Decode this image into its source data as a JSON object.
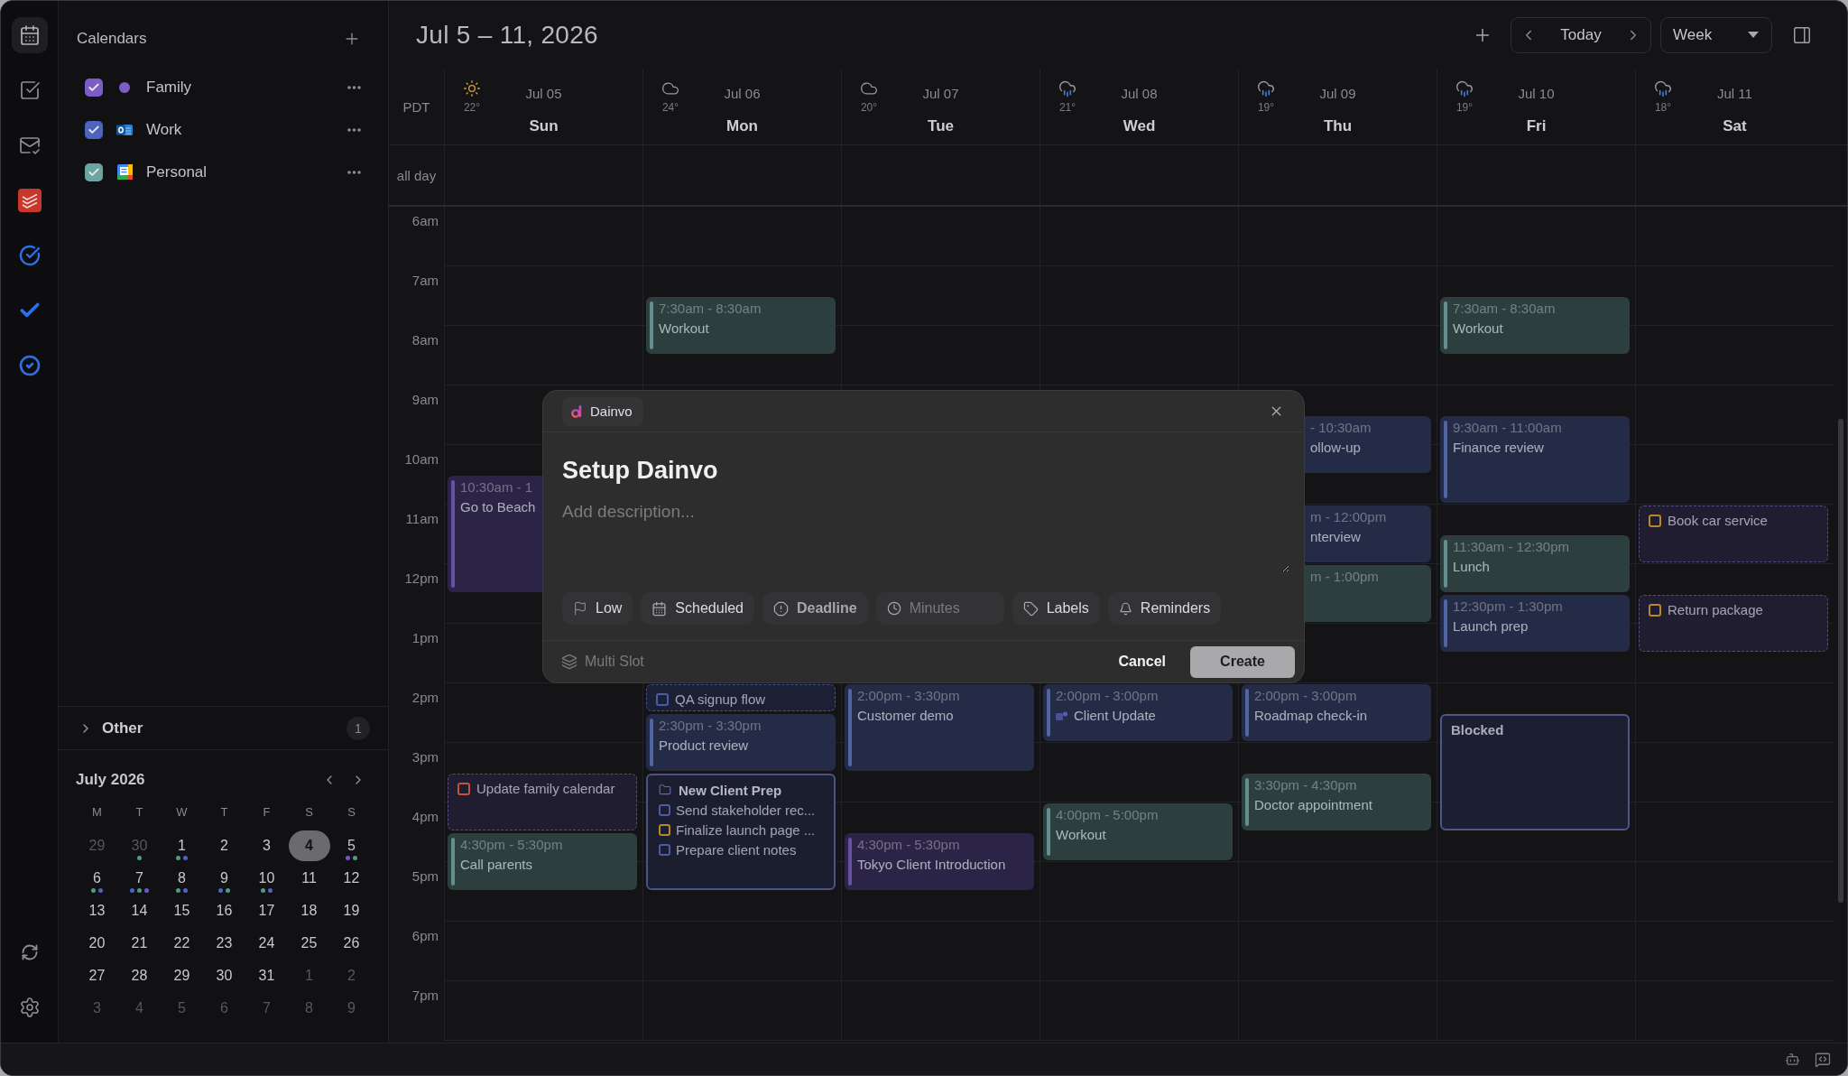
{
  "rail": [
    {
      "selected": true
    },
    {
      "selected": false
    },
    {
      "selected": false
    },
    {
      "selected": false
    },
    {
      "selected": false
    },
    {
      "selected": false
    },
    {
      "selected": false
    }
  ],
  "sidebar": {
    "title": "Calendars",
    "calendars": [
      {
        "name": "Family",
        "checked": true,
        "color": "#7b5cc8"
      },
      {
        "name": "Work",
        "checked": true,
        "color": "#4d63bd"
      },
      {
        "name": "Personal",
        "checked": true,
        "color": "#6aa5a2"
      }
    ],
    "other": {
      "label": "Other",
      "count": "1",
      "expanded": false
    },
    "mini_calendar": {
      "title": "July 2026",
      "weekdays": [
        "M",
        "T",
        "W",
        "T",
        "F",
        "S",
        "S"
      ],
      "weeks": [
        [
          {
            "day": "29",
            "outside": true,
            "selected": false
          },
          {
            "day": "30",
            "outside": true,
            "selected": false,
            "dots": [
              {
                "color": "#4e9a8c"
              }
            ]
          },
          {
            "day": "1",
            "outside": false,
            "selected": false,
            "dots": [
              {
                "color": "#4e9a8c"
              },
              {
                "color": "#5063c2"
              }
            ]
          },
          {
            "day": "2",
            "outside": false,
            "selected": false
          },
          {
            "day": "3",
            "outside": false,
            "selected": false
          },
          {
            "day": "4",
            "outside": false,
            "selected": true
          },
          {
            "day": "5",
            "outside": false,
            "selected": false,
            "dots": [
              {
                "color": "#7656c4"
              },
              {
                "color": "#4e9a8c"
              }
            ]
          }
        ],
        [
          {
            "day": "6",
            "outside": false,
            "selected": false,
            "dots": [
              {
                "color": "#4e9a8c"
              },
              {
                "color": "#5063c2"
              }
            ]
          },
          {
            "day": "7",
            "outside": false,
            "selected": false,
            "dots": [
              {
                "color": "#5063c2"
              },
              {
                "color": "#4e9a8c"
              },
              {
                "color": "#7656c4"
              }
            ]
          },
          {
            "day": "8",
            "outside": false,
            "selected": false,
            "dots": [
              {
                "color": "#4e9a8c"
              },
              {
                "color": "#5063c2"
              }
            ]
          },
          {
            "day": "9",
            "outside": false,
            "selected": false,
            "dots": [
              {
                "color": "#5063c2"
              },
              {
                "color": "#4e9a8c"
              }
            ]
          },
          {
            "day": "10",
            "outside": false,
            "selected": false,
            "dots": [
              {
                "color": "#4e9a8c"
              },
              {
                "color": "#5063c2"
              }
            ]
          },
          {
            "day": "11",
            "outside": false,
            "selected": false
          },
          {
            "day": "12",
            "outside": false,
            "selected": false
          }
        ],
        [
          {
            "day": "13",
            "outside": false,
            "selected": false
          },
          {
            "day": "14",
            "outside": false,
            "selected": false
          },
          {
            "day": "15",
            "outside": false,
            "selected": false
          },
          {
            "day": "16",
            "outside": false,
            "selected": false
          },
          {
            "day": "17",
            "outside": false,
            "selected": false
          },
          {
            "day": "18",
            "outside": false,
            "selected": false
          },
          {
            "day": "19",
            "outside": false,
            "selected": false
          }
        ],
        [
          {
            "day": "20",
            "outside": false,
            "selected": false
          },
          {
            "day": "21",
            "outside": false,
            "selected": false
          },
          {
            "day": "22",
            "outside": false,
            "selected": false
          },
          {
            "day": "23",
            "outside": false,
            "selected": false
          },
          {
            "day": "24",
            "outside": false,
            "selected": false
          },
          {
            "day": "25",
            "outside": false,
            "selected": false
          },
          {
            "day": "26",
            "outside": false,
            "selected": false
          }
        ],
        [
          {
            "day": "27",
            "outside": false,
            "selected": false
          },
          {
            "day": "28",
            "outside": false,
            "selected": false
          },
          {
            "day": "29",
            "outside": false,
            "selected": false
          },
          {
            "day": "30",
            "outside": false,
            "selected": false
          },
          {
            "day": "31",
            "outside": false,
            "selected": false
          },
          {
            "day": "1",
            "outside": true,
            "selected": false
          },
          {
            "day": "2",
            "outside": true,
            "selected": false
          }
        ],
        [
          {
            "day": "3",
            "outside": true,
            "selected": false
          },
          {
            "day": "4",
            "outside": true,
            "selected": false
          },
          {
            "day": "5",
            "outside": true,
            "selected": false
          },
          {
            "day": "6",
            "outside": true,
            "selected": false
          },
          {
            "day": "7",
            "outside": true,
            "selected": false
          },
          {
            "day": "8",
            "outside": true,
            "selected": false
          },
          {
            "day": "9",
            "outside": true,
            "selected": false
          }
        ]
      ]
    }
  },
  "header": {
    "title": "Jul 5 – 11, 2026",
    "today": "Today",
    "view": "Week"
  },
  "week": {
    "timezone": "PDT",
    "all_day": "all day",
    "hours": [
      "6am",
      "7am",
      "8am",
      "9am",
      "10am",
      "11am",
      "12pm",
      "1pm",
      "2pm",
      "3pm",
      "4pm",
      "5pm",
      "6pm",
      "7pm"
    ],
    "days": [
      {
        "kind": "sun",
        "temp": "22°",
        "date": "Jul 05",
        "name": "Sun",
        "events": [
          {
            "kind": "event",
            "time": "10:30am - 1",
            "title": "Go to Beach",
            "color": "#2c2446"
          },
          {
            "kind": "task",
            "title": "Update family calendar",
            "checkbox": {
              "checked": false,
              "color": "#c4513c"
            },
            "color": "#211d30"
          },
          {
            "kind": "event",
            "time": "4:30pm - 5:30pm",
            "title": "Call parents",
            "color": "#2c3e3e"
          }
        ]
      },
      {
        "kind": "cloud",
        "temp": "24°",
        "date": "Jul 06",
        "name": "Mon",
        "events": [
          {
            "kind": "event",
            "time": "7:30am - 8:30am",
            "title": "Workout",
            "color": "#2c3e3e"
          },
          {
            "kind": "task",
            "title": "QA signup flow",
            "checkbox": {
              "checked": false,
              "color": "#4a5ca6"
            },
            "color": "#1b2034"
          },
          {
            "kind": "event",
            "time": "2:30pm - 3:30pm",
            "title": "Product review",
            "color": "#232b46"
          },
          {
            "kind": "group",
            "title": "New Client Prep",
            "color": "#1a1e2f",
            "items": [
              {
                "title": "Send stakeholder rec...",
                "checked": false,
                "color": "#4a5ca6"
              },
              {
                "title": "Finalize launch page ...",
                "checked": false,
                "color": "#b8862c"
              },
              {
                "title": "Prepare client notes",
                "checked": false,
                "color": "#4a5ca6"
              }
            ]
          }
        ]
      },
      {
        "kind": "cloud",
        "temp": "20°",
        "date": "Jul 07",
        "name": "Tue",
        "events": [
          {
            "kind": "event",
            "time": "2:00pm - 3:30pm",
            "title": "Customer demo",
            "color": "#232b46"
          },
          {
            "kind": "event",
            "time": "4:30pm - 5:30pm",
            "title": "Tokyo Client Introduction",
            "color": "#2c2446"
          }
        ]
      },
      {
        "kind": "rain",
        "temp": "21°",
        "date": "Jul 08",
        "name": "Wed",
        "events": [
          {
            "kind": "meeting",
            "time": "2:00pm - 3:00pm",
            "title": "Client Update",
            "color": "#232b46"
          },
          {
            "kind": "event",
            "time": "4:00pm - 5:00pm",
            "title": "Workout",
            "color": "#2c3e3e"
          }
        ]
      },
      {
        "kind": "rain",
        "temp": "19°",
        "date": "Jul 09",
        "name": "Thu",
        "events": [
          {
            "kind": "event",
            "time": "- 10:30am",
            "title": "ollow-up",
            "color": "#232b46"
          },
          {
            "kind": "event",
            "time": "m - 12:00pm",
            "title": "nterview",
            "color": "#232b46"
          },
          {
            "kind": "event",
            "time": "m - 1:00pm",
            "color": "#2c3e3e"
          },
          {
            "kind": "event",
            "time": "2:00pm - 3:00pm",
            "title": "Roadmap check-in",
            "color": "#232b46"
          },
          {
            "kind": "event",
            "time": "3:30pm - 4:30pm",
            "title": "Doctor appointment",
            "color": "#2c3e3e"
          }
        ]
      },
      {
        "kind": "rain",
        "temp": "19°",
        "date": "Jul 10",
        "name": "Fri",
        "events": [
          {
            "kind": "event",
            "time": "7:30am - 8:30am",
            "title": "Workout",
            "color": "#2c3e3e"
          },
          {
            "kind": "event",
            "time": "9:30am - 11:00am",
            "title": "Finance review",
            "color": "#232b46"
          },
          {
            "kind": "event",
            "time": "11:30am - 12:30pm",
            "title": "Lunch",
            "color": "#2c3e3e"
          },
          {
            "kind": "event",
            "time": "12:30pm - 1:30pm",
            "title": "Launch prep",
            "color": "#232b46"
          },
          {
            "kind": "blocked",
            "title": "Blocked",
            "color": "#1b1f31"
          }
        ]
      },
      {
        "kind": "rain",
        "temp": "18°",
        "date": "Jul 11",
        "name": "Sat",
        "events": [
          {
            "kind": "task",
            "title": "Book car service",
            "checkbox": {
              "checked": false,
              "color": "#b8862c"
            },
            "color": "#211d30"
          },
          {
            "kind": "task",
            "title": "Return package",
            "checkbox": {
              "checked": false,
              "color": "#b8862c"
            },
            "color": "#211d30"
          }
        ]
      }
    ]
  },
  "dialog": {
    "source": "Dainvo",
    "title": "Setup Dainvo",
    "description": {
      "placeholder": "Add description..."
    },
    "chips": [
      {
        "kind": "button",
        "label": "Low"
      },
      {
        "kind": "button",
        "label": "Scheduled"
      },
      {
        "kind": "strong",
        "label": "Deadline"
      },
      {
        "kind": "input",
        "placeholder": "Minutes"
      },
      {
        "kind": "button",
        "label": "Labels"
      },
      {
        "kind": "button",
        "label": "Reminders"
      }
    ],
    "multi_slot": "Multi Slot",
    "cancel": "Cancel",
    "create": "Create"
  }
}
